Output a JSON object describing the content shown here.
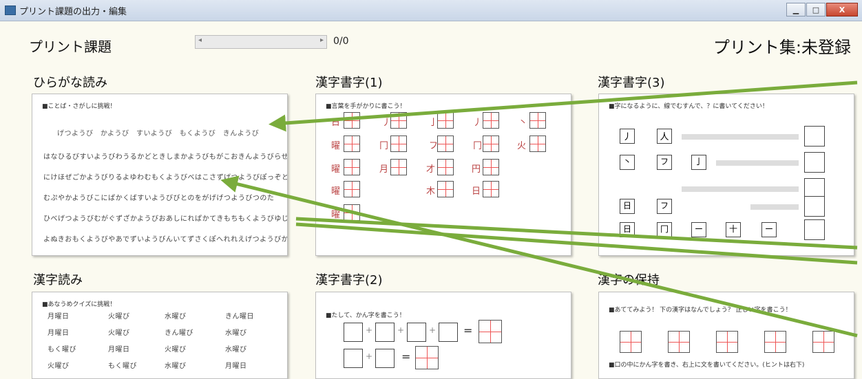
{
  "window": {
    "title": "プリント課題の出力・編集",
    "buttons": [
      "▁",
      "□",
      "X"
    ]
  },
  "header": {
    "title": "プリント課題",
    "counter": "0/0",
    "collection": "プリント集:未登録",
    "scroll_left": "◂",
    "scroll_right": "▸"
  },
  "cards": [
    {
      "title": "ひらがな読み",
      "head": "■ことば・さがしに挑戦！",
      "lines": [
        "げつようび　かようび　すいようび　もくようび　きんようび",
        "はなひるびすいようびわうるかどときしまかようびもがこおきんようびらせぬず",
        "にけほぜごかようびりるよゆわむもくようびべはこさずげつようびぽっぞとれ",
        "むぷやかようびこにぱかくばすいようびびとのをがげげつようびつのた",
        "ひべげつようびむがぐずざかようびおあしにれぱかてきもちもくようびゆじべ",
        "よぬきおもくようびやあでずいようびんいてずさくぽへれれえげつようびかに"
      ]
    },
    {
      "title": "漢字書字(1)",
      "head": "■言葉を手がかりに書こう！",
      "glyphs": [
        "日",
        "丿",
        "亅",
        "丿",
        "丶",
        "曜",
        "冂",
        "フ",
        "冂",
        "火",
        "曜",
        "月",
        "才",
        "円",
        "曜",
        "木",
        "日",
        "曜"
      ]
    },
    {
      "title": "漢字書字(3)",
      "head": "■字になるように、線でむすんで、？に書いてください！",
      "glyphs": [
        "丿",
        "人",
        "丶",
        "フ",
        "亅",
        "フ",
        "日",
        "冂",
        "ー",
        "十",
        "ー"
      ]
    },
    {
      "title": "漢字読み",
      "head": "■あなうめクイズに挑戦！",
      "rows": [
        [
          "月曜日",
          "火曜び",
          "水曜び",
          "きん曜日"
        ],
        [
          "月曜日",
          "火曜び",
          "きん曜び",
          "水曜び"
        ],
        [
          "もく曜び",
          "月曜日",
          "火曜び",
          "水曜び"
        ],
        [
          "火曜び",
          "もく曜び",
          "水曜び",
          "月曜日"
        ]
      ]
    },
    {
      "title": "漢字書字(2)",
      "head": "■たして、かん字を書こう！",
      "plus": "+",
      "equals": "="
    },
    {
      "title": "漢字の保持",
      "head": "■あててみよう！ 下の漢字はなんでしょう？ 正しい字を書こう！",
      "foot": "■口の中にかん字を書き、右上に文を書いてください。(ヒントは右下)"
    }
  ]
}
